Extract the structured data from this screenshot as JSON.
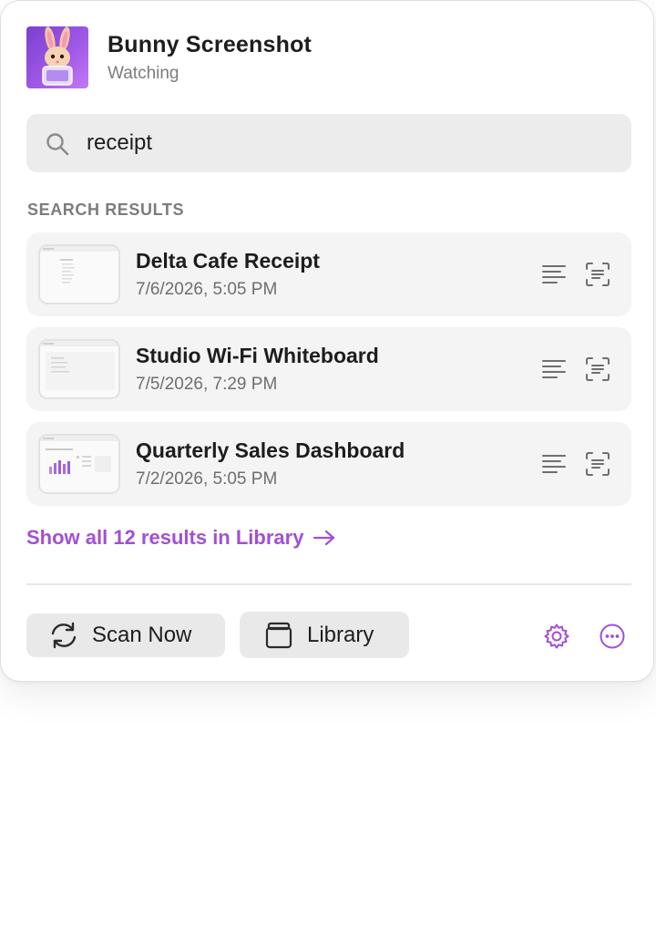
{
  "app": {
    "title": "Bunny Screenshot",
    "status": "Watching"
  },
  "search": {
    "value": "receipt"
  },
  "results_section": {
    "label": "SEARCH RESULTS"
  },
  "results": [
    {
      "title": "Delta Cafe Receipt",
      "date": "7/6/2026, 5:05 PM"
    },
    {
      "title": "Studio Wi-Fi Whiteboard",
      "date": "7/5/2026, 7:29 PM"
    },
    {
      "title": "Quarterly Sales Dashboard",
      "date": "7/2/2026, 5:05 PM"
    }
  ],
  "show_all": {
    "label": "Show all 12 results in Library"
  },
  "footer": {
    "scan_label": "Scan Now",
    "library_label": "Library"
  },
  "colors": {
    "accent": "#a24fd6",
    "panel_bg": "#ffffff",
    "row_bg": "#f4f4f4",
    "button_bg": "#e9e9e9",
    "secondary_text": "#7c7c80"
  }
}
